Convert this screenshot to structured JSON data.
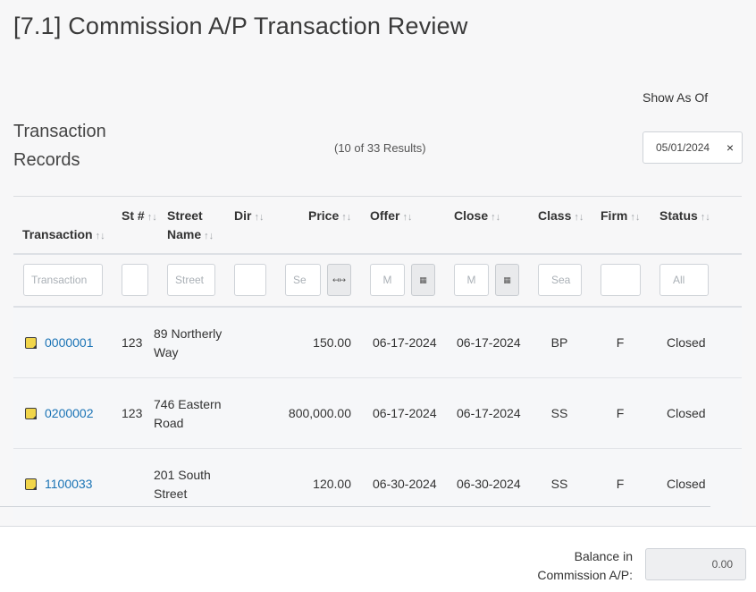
{
  "page": {
    "title": "[7.1] Commission A/P Transaction Review",
    "section_title": "Transaction Records",
    "results_text": "(10 of 33 Results)",
    "show_as_of_label": "Show As Of",
    "show_as_of_value": "05/01/2024",
    "clear_glyph": "×"
  },
  "table": {
    "columns": [
      {
        "key": "transaction",
        "label": "Transaction",
        "sort": "↑↓"
      },
      {
        "key": "st",
        "label": "St #",
        "sort": "↑↓"
      },
      {
        "key": "street",
        "label": "Street Name",
        "sort": "↑↓"
      },
      {
        "key": "dir",
        "label": "Dir",
        "sort": "↑↓"
      },
      {
        "key": "price",
        "label": "Price",
        "sort": "↑↓"
      },
      {
        "key": "offer",
        "label": "Offer",
        "sort": "↑↓"
      },
      {
        "key": "close",
        "label": "Close",
        "sort": "↑↓"
      },
      {
        "key": "class",
        "label": "Class",
        "sort": "↑↓"
      },
      {
        "key": "firm",
        "label": "Firm",
        "sort": "↑↓"
      },
      {
        "key": "status",
        "label": "Status",
        "sort": "↑↓"
      }
    ],
    "filters": {
      "transaction": "Transaction",
      "st": "",
      "street": "Street",
      "dir": "",
      "price": "Se",
      "price_btn": "↤↦",
      "offer": "M",
      "offer_btn": "▦",
      "close": "M",
      "close_btn": "▦",
      "class": "Sea",
      "firm": "",
      "status": "All"
    },
    "rows": [
      {
        "transaction": "0000001",
        "st": "123",
        "street": "89 Northerly Way",
        "dir": "",
        "price": "150.00",
        "offer": "06-17-2024",
        "close": "06-17-2024",
        "class": "BP",
        "firm": "F",
        "status": "Closed"
      },
      {
        "transaction": "0200002",
        "st": "123",
        "street": "746 Eastern Road",
        "dir": "",
        "price": "800,000.00",
        "offer": "06-17-2024",
        "close": "06-17-2024",
        "class": "SS",
        "firm": "F",
        "status": "Closed"
      },
      {
        "transaction": "1100033",
        "st": "",
        "street": "201 South Street",
        "dir": "",
        "price": "120.00",
        "offer": "06-30-2024",
        "close": "06-30-2024",
        "class": "SS",
        "firm": "F",
        "status": "Closed"
      }
    ]
  },
  "footer": {
    "balance_label": "Balance in Commission A/P:",
    "balance_value": "0.00"
  }
}
